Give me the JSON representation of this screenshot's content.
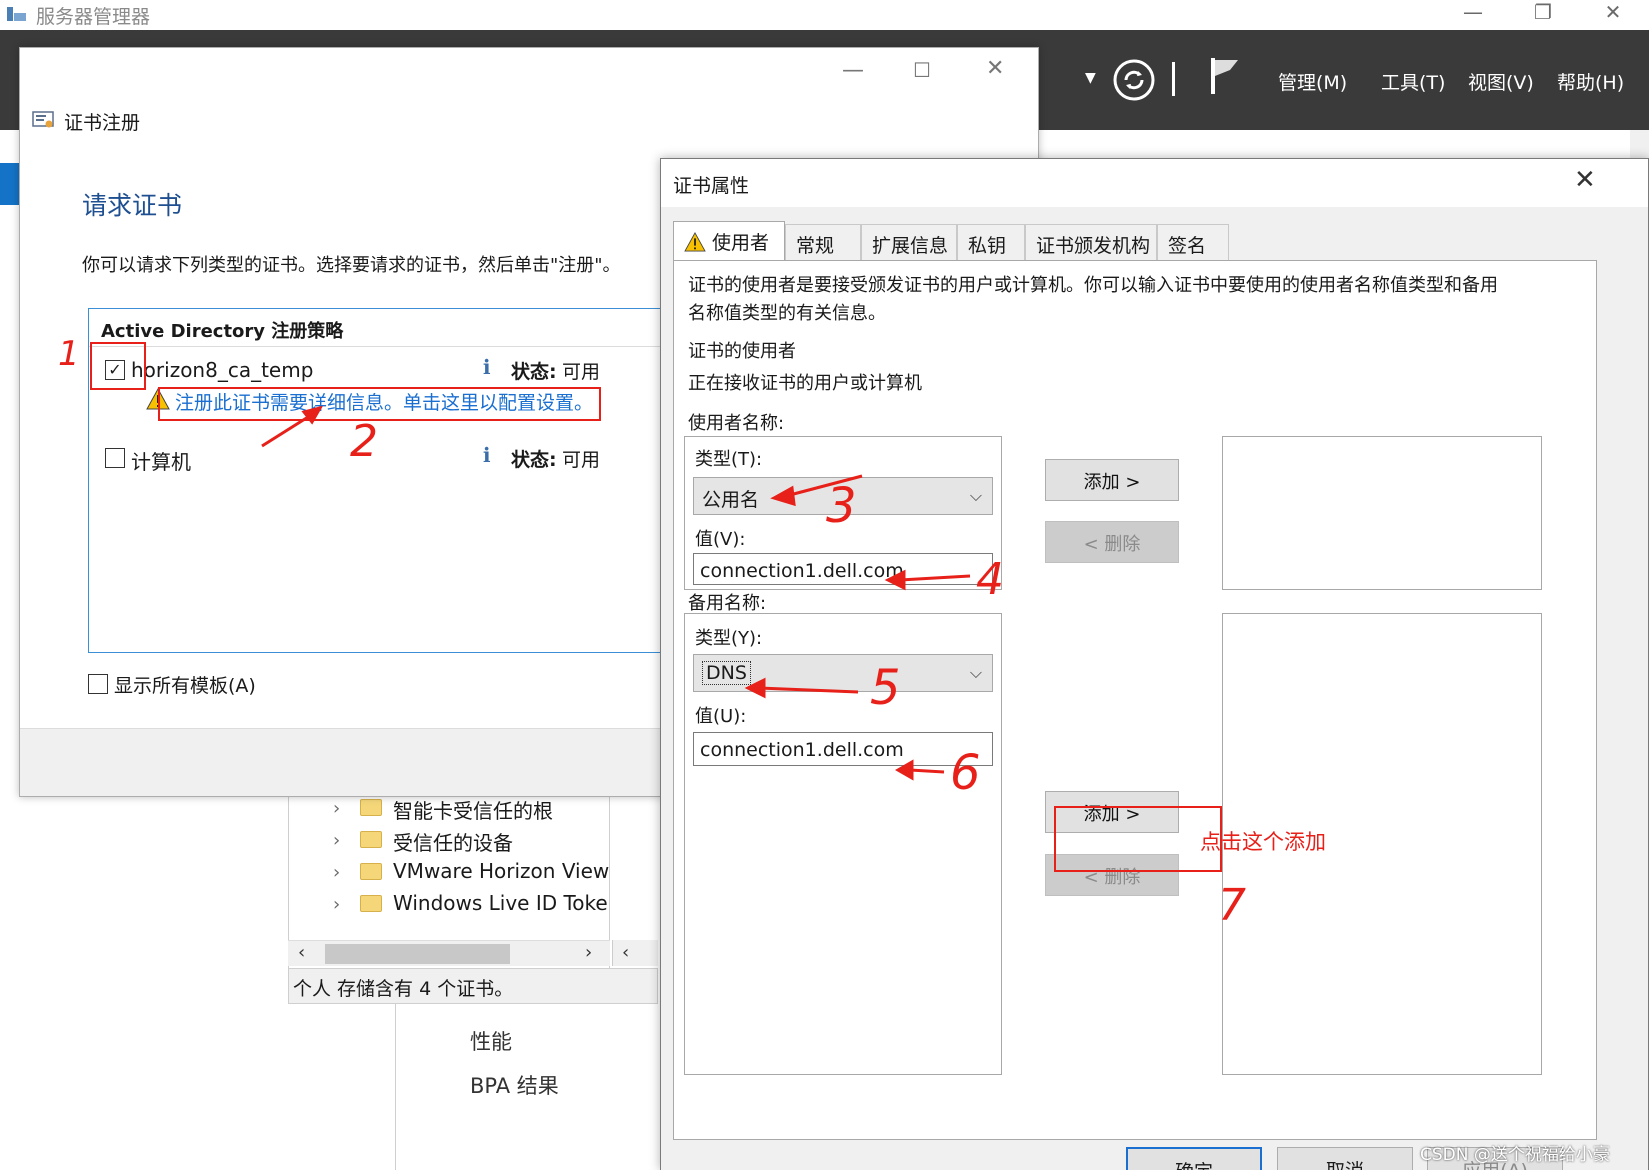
{
  "server_manager": {
    "title": "服务器管理器",
    "menu": {
      "manage": "管理(M)",
      "tools": "工具(T)",
      "view": "视图(V)",
      "help": "帮助(H)"
    },
    "tree_items": [
      "智能卡受信任的根",
      "受信任的设备",
      "VMware Horizon View",
      "Windows Live ID Toker"
    ],
    "status_bar": "个人 存储含有 4 个证书。",
    "nav_items": [
      "性能",
      "BPA 结果"
    ]
  },
  "cert_enrollment": {
    "title": "证书注册",
    "heading": "请求证书",
    "description": "你可以请求下列类型的证书。选择要请求的证书，然后单击\"注册\"。",
    "policy_title": "Active Directory 注册策略",
    "templates": [
      {
        "name": "horizon8_ca_temp",
        "checked": true,
        "status_label": "状态:",
        "status_value": "可用",
        "warning": "注册此证书需要详细信息。单击这里以配置设置。"
      },
      {
        "name": "计算机",
        "checked": false,
        "status_label": "状态:",
        "status_value": "可用"
      }
    ],
    "show_all_label": "显示所有模板(A)"
  },
  "cert_properties": {
    "title": "证书属性",
    "tabs": [
      "使用者",
      "常规",
      "扩展信息",
      "私钥",
      "证书颁发机构",
      "签名"
    ],
    "intro": [
      "证书的使用者是要接受颁发证书的用户或计算机。你可以输入证书中要使用的使用者名称值类型和备用",
      "名称值类型的有关信息。"
    ],
    "subject_heading": "证书的使用者",
    "subject_desc": "正在接收证书的用户或计算机",
    "subject_name": {
      "group_label": "使用者名称:",
      "type_label": "类型(T):",
      "type_value": "公用名",
      "value_label": "值(V):",
      "value": "connection1.dell.com"
    },
    "alt_name": {
      "group_label": "备用名称:",
      "type_label": "类型(Y):",
      "type_value": "DNS",
      "value_label": "值(U):",
      "value": "connection1.dell.com"
    },
    "add_label": "添加 >",
    "remove_label": "< 删除",
    "ok_label": "确定",
    "cancel_label": "取消",
    "apply_label": "应用(A)"
  },
  "annotations": {
    "n1": "1",
    "n2": "2",
    "n3": "3",
    "n4": "4",
    "n5": "5",
    "n6": "6",
    "n7": "7",
    "note": "点击这个添加",
    "color": "#e8201a"
  },
  "watermark": "CSDN @送个祝福给小豪"
}
